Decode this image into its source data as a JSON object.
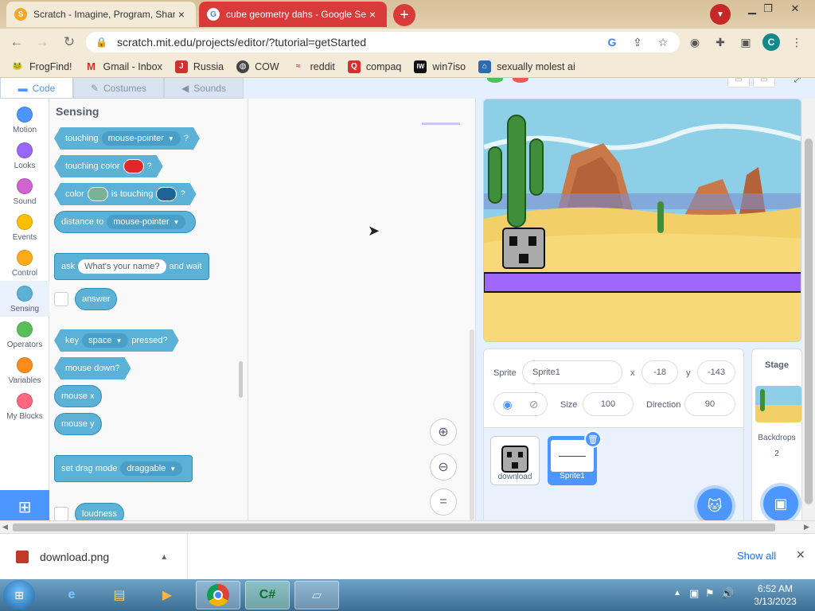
{
  "browser": {
    "tabs": [
      {
        "title": "Scratch - Imagine, Program, Share",
        "close": "×"
      },
      {
        "title": "cube geometry dahs - Google Se",
        "close": "×"
      }
    ],
    "new_tab": "+",
    "url": "scratch.mit.edu/projects/editor/?tutorial=getStarted",
    "profile_initial": "C",
    "bookmarks": [
      {
        "label": "FrogFind!",
        "icon": "frog-icon"
      },
      {
        "label": "Gmail - Inbox",
        "icon": "gmail-icon"
      },
      {
        "label": "Russia",
        "icon": "russia-icon"
      },
      {
        "label": "COW",
        "icon": "globe-icon"
      },
      {
        "label": "reddit",
        "icon": "reddit-icon"
      },
      {
        "label": "compaq",
        "icon": "compaq-icon"
      },
      {
        "label": "win7iso",
        "icon": "iw-icon"
      },
      {
        "label": "sexually molest ai",
        "icon": "ai-icon"
      }
    ]
  },
  "editor": {
    "tabs": [
      "Code",
      "Costumes",
      "Sounds"
    ],
    "categories": [
      {
        "label": "Motion",
        "color": "#4c97ff"
      },
      {
        "label": "Looks",
        "color": "#9966ff"
      },
      {
        "label": "Sound",
        "color": "#cf63cf"
      },
      {
        "label": "Events",
        "color": "#ffbf00"
      },
      {
        "label": "Control",
        "color": "#ffab19"
      },
      {
        "label": "Sensing",
        "color": "#5cb1d6"
      },
      {
        "label": "Operators",
        "color": "#59c059"
      },
      {
        "label": "Variables",
        "color": "#ff8c1a"
      },
      {
        "label": "My Blocks",
        "color": "#ff6680"
      }
    ],
    "palette_title": "Sensing",
    "blocks": {
      "touching": {
        "label": "touching",
        "menu": "mouse-pointer",
        "q": "?"
      },
      "touching_color": {
        "label": "touching color",
        "q": "?",
        "color": "#e0282c"
      },
      "color_touching": {
        "label1": "color",
        "label2": "is touching",
        "q": "?",
        "color1": "#79b296",
        "color2": "#1f6396"
      },
      "distance_to": {
        "label": "distance to",
        "menu": "mouse-pointer"
      },
      "ask": {
        "label1": "ask",
        "input": "What's your name?",
        "label2": "and wait"
      },
      "answer": "answer",
      "key_pressed": {
        "label1": "key",
        "menu": "space",
        "label2": "pressed?"
      },
      "mouse_down": "mouse down?",
      "mouse_x": "mouse x",
      "mouse_y": "mouse y",
      "drag_mode": {
        "label": "set drag mode",
        "menu": "draggable"
      },
      "loudness": "loudness"
    }
  },
  "sprite_info": {
    "sprite_label": "Sprite",
    "sprite_name": "Sprite1",
    "x_label": "x",
    "x_value": "-18",
    "y_label": "y",
    "y_value": "-143",
    "size_label": "Size",
    "size_value": "100",
    "direction_label": "Direction",
    "direction_value": "90",
    "sprites": [
      {
        "name": "download"
      },
      {
        "name": "Sprite1"
      }
    ]
  },
  "stage_panel": {
    "title": "Stage",
    "backdrops_label": "Backdrops",
    "backdrops_count": "2"
  },
  "downloads": {
    "file": "download.png",
    "show_all": "Show all"
  },
  "taskbar": {
    "time": "6:52 AM",
    "date": "3/13/2023",
    "apps": [
      "ie-icon",
      "explorer-icon",
      "media-player-icon",
      "chrome-icon",
      "csharp-icon",
      "notepad-icon"
    ]
  }
}
